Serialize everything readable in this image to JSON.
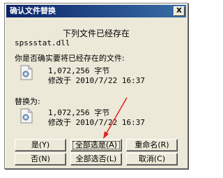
{
  "window": {
    "title": "确认文件替换",
    "close_label": "X"
  },
  "dialog": {
    "heading": "下列文件已经存在",
    "filename": "spssstat.dll",
    "question": "你是否确实要将已经存在的文件:",
    "existing_file": {
      "size": "1,072,256 字节",
      "modified": "修改于 2010/7/22 16:37"
    },
    "replace_label": "替换为:",
    "new_file": {
      "size": "1,072,256 字节",
      "modified": "修改于 2010/7/22 16:37"
    }
  },
  "buttons": {
    "yes": "是(Y)",
    "yes_all": "全部选是(A)",
    "rename": "重命名(R)",
    "no": "否(N)",
    "no_all": "全部选否(L)",
    "cancel": "取消(C)"
  },
  "colors": {
    "titlebar": "#0a246a",
    "dialog_bg": "#ece9d8",
    "annotation_arrow": "#e02020"
  },
  "icons": {
    "file": "dll-file-icon",
    "close": "close-icon"
  }
}
